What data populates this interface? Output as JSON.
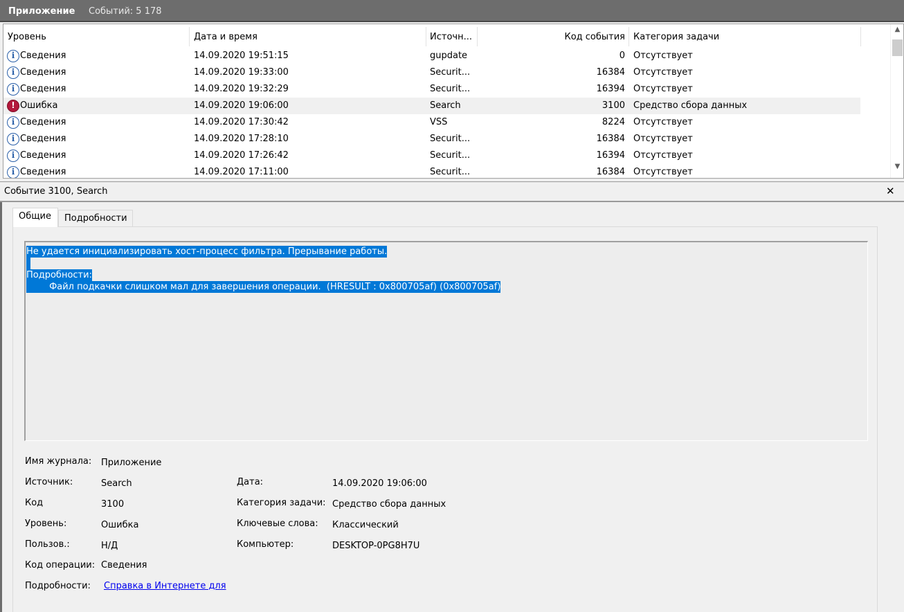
{
  "titlebar": {
    "log_name": "Приложение",
    "events_count": "Событий: 5 178"
  },
  "columns": {
    "level": "Уровень",
    "datetime": "Дата и время",
    "source": "Источн...",
    "event_id": "Код события",
    "task_category": "Категория задачи"
  },
  "events": [
    {
      "type": "info",
      "level": "Сведения",
      "datetime": "14.09.2020 19:51:15",
      "source": "gupdate",
      "event_id": "0",
      "category": "Отсутствует"
    },
    {
      "type": "info",
      "level": "Сведения",
      "datetime": "14.09.2020 19:33:00",
      "source": "Securit...",
      "event_id": "16384",
      "category": "Отсутствует"
    },
    {
      "type": "info",
      "level": "Сведения",
      "datetime": "14.09.2020 19:32:29",
      "source": "Securit...",
      "event_id": "16394",
      "category": "Отсутствует"
    },
    {
      "type": "error",
      "level": "Ошибка",
      "datetime": "14.09.2020 19:06:00",
      "source": "Search",
      "event_id": "3100",
      "category": "Средство сбора данных"
    },
    {
      "type": "info",
      "level": "Сведения",
      "datetime": "14.09.2020 17:30:42",
      "source": "VSS",
      "event_id": "8224",
      "category": "Отсутствует"
    },
    {
      "type": "info",
      "level": "Сведения",
      "datetime": "14.09.2020 17:28:10",
      "source": "Securit...",
      "event_id": "16384",
      "category": "Отсутствует"
    },
    {
      "type": "info",
      "level": "Сведения",
      "datetime": "14.09.2020 17:26:42",
      "source": "Securit...",
      "event_id": "16394",
      "category": "Отсутствует"
    },
    {
      "type": "info",
      "level": "Сведения",
      "datetime": "14.09.2020 17:11:00",
      "source": "Securit...",
      "event_id": "16384",
      "category": "Отсутствует"
    }
  ],
  "icons": {
    "info": "info-icon",
    "error": "error-icon",
    "close": "close-icon",
    "scroll_up": "chevron-up-icon",
    "scroll_down": "chevron-down-icon"
  },
  "detail": {
    "title": "Событие 3100, Search",
    "close_glyph": "✕",
    "tabs": {
      "general": "Общие",
      "details": "Подробности"
    },
    "message": {
      "line1": "Не удается инициализировать хост-процесс фильтра. Прерывание работы.",
      "line2": "Подробности:",
      "line3": "\tФайл подкачки слишком мал для завершения операции.  (HRESULT : 0x800705af) (0x800705af)"
    },
    "fields": {
      "log_label": "Имя журнала:",
      "log_value": "Приложение",
      "source_label": "Источник:",
      "source_value": "Search",
      "date_label": "Дата:",
      "date_value": "14.09.2020 19:06:00",
      "code_label": "Код",
      "code_value": "3100",
      "category_label": "Категория задачи:",
      "category_value": "Средство сбора данных",
      "level_label": "Уровень:",
      "level_value": "Ошибка",
      "keywords_label": "Ключевые слова:",
      "keywords_value": "Классический",
      "user_label": "Пользов.:",
      "user_value": "Н/Д",
      "computer_label": "Компьютер:",
      "computer_value": "DESKTOP-0PG8H7U",
      "opcode_label": "Код операции:",
      "opcode_value": "Сведения",
      "more_label": "Подробности:",
      "more_link": "Справка в Интернете для"
    }
  },
  "colors": {
    "selection": "#0078d7",
    "error_icon": "#b3183b",
    "info_icon": "#2a5fa8",
    "titlebar": "#6d6d6d",
    "link": "#0000ee"
  }
}
